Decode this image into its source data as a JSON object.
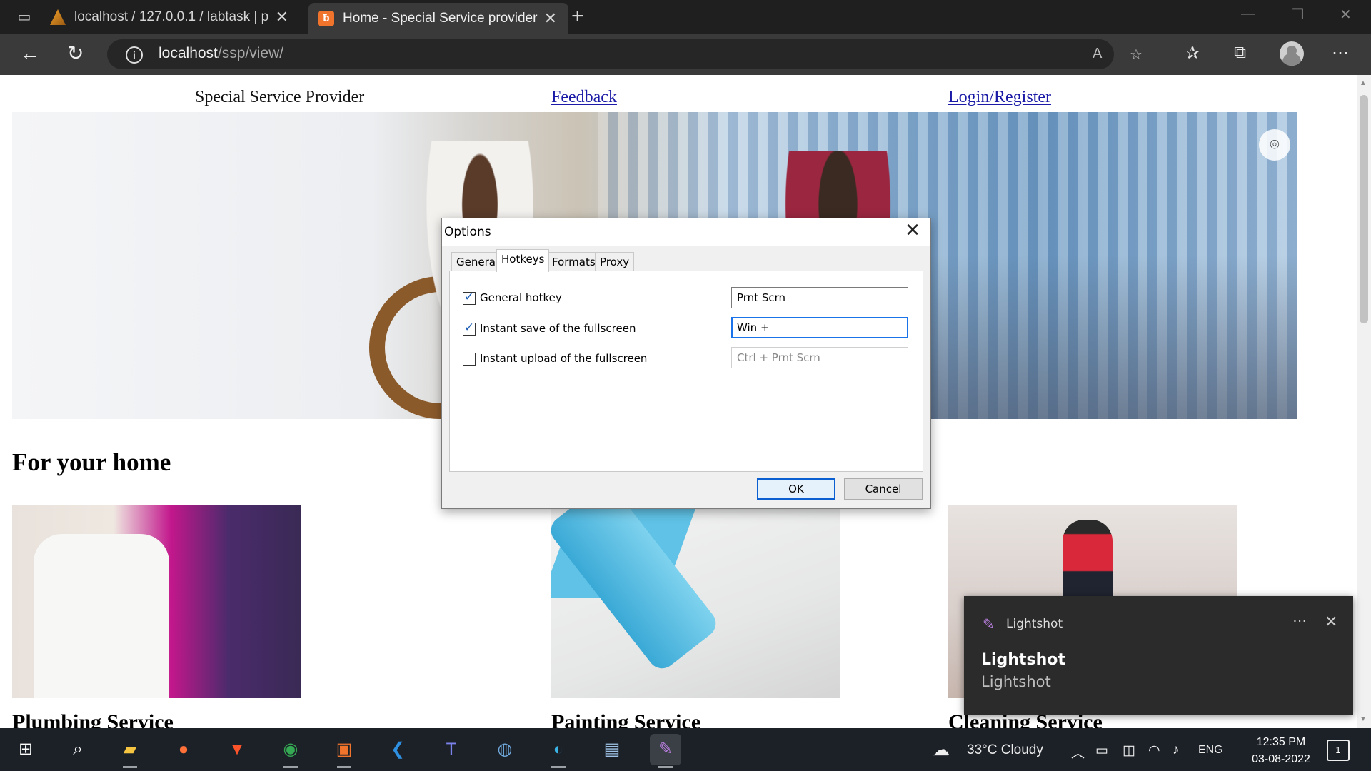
{
  "browser": {
    "tabs": [
      {
        "label": "localhost / 127.0.0.1 / labtask | p"
      },
      {
        "label": "Home - Special Service provider",
        "active": true
      }
    ],
    "new_tab_icon": "+",
    "url_host": "localhost",
    "url_path": "/ssp/view/"
  },
  "page": {
    "nav_title": "Special Service Provider",
    "nav_links": [
      "Feedback",
      "Login/Register"
    ],
    "section_heading": "For your home",
    "cards": [
      {
        "label": "Plumbing Service"
      },
      {
        "label": "Painting Service"
      },
      {
        "label": "Cleaning Service"
      }
    ]
  },
  "dialog": {
    "title": "Options",
    "tabs": [
      "General",
      "Hotkeys",
      "Formats",
      "Proxy"
    ],
    "active_tab": "Hotkeys",
    "rows": [
      {
        "label": "General hotkey",
        "checked": true,
        "value": "Prnt Scrn"
      },
      {
        "label": "Instant save of the fullscreen",
        "checked": true,
        "value": "Win +"
      },
      {
        "label": "Instant upload of the fullscreen",
        "checked": false,
        "value": "Ctrl + Prnt Scrn"
      }
    ],
    "ok_label": "OK",
    "cancel_label": "Cancel"
  },
  "toast": {
    "app_name": "Lightshot",
    "title": "Lightshot",
    "body": "Lightshot"
  },
  "taskbar": {
    "weather": "33°C  Cloudy",
    "language": "ENG",
    "time": "12:35 PM",
    "date": "03-08-2022",
    "notification_count": "1"
  },
  "colors": {
    "link": "#1a1aa6",
    "accent": "#1a73e8",
    "toast_bg": "#2b2b2b",
    "taskbar_bg": "#1c2128"
  },
  "icons": [
    "sidebar-tabs-icon",
    "back-icon",
    "refresh-icon",
    "info-icon",
    "read-aloud-icon",
    "add-favorite-icon",
    "favorites-icon",
    "collections-icon",
    "profile-icon",
    "more-icon",
    "visual-search-icon",
    "windows-start-icon",
    "search-icon",
    "file-explorer-icon",
    "firefox-icon",
    "brave-icon",
    "chrome-icon",
    "xampp-icon",
    "vscode-icon",
    "teams-icon",
    "edge-icon",
    "lightshot-icon",
    "cloud-icon",
    "wifi-icon",
    "volume-icon",
    "battery-icon"
  ]
}
